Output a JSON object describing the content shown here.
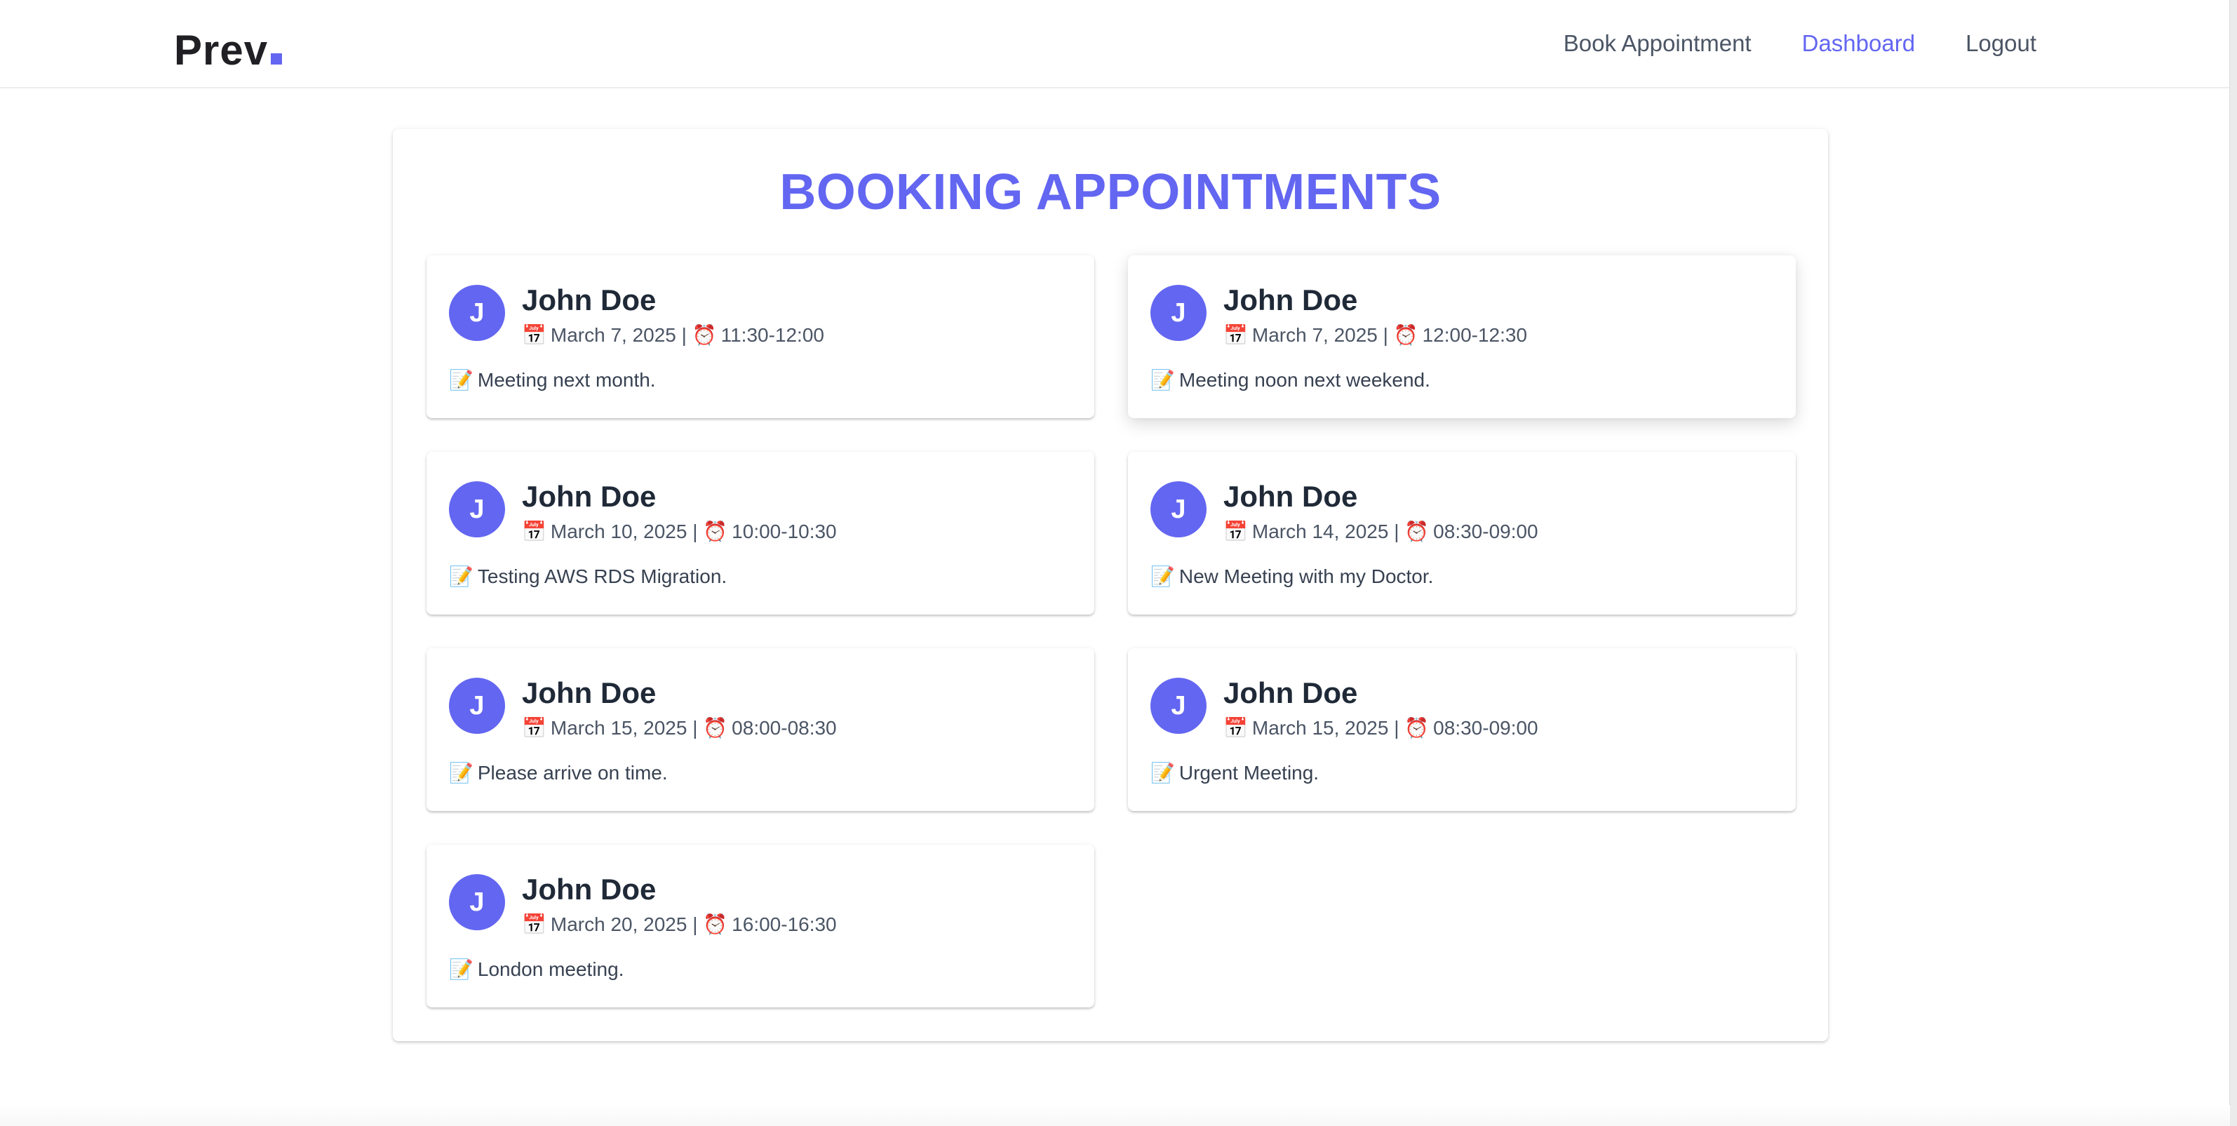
{
  "header": {
    "logo_text": "Prev",
    "nav": [
      {
        "label": "Book Appointment"
      },
      {
        "label": "Dashboard"
      },
      {
        "label": "Logout"
      }
    ]
  },
  "panel": {
    "title": "BOOKING APPOINTMENTS"
  },
  "icons": {
    "calendar": "📅",
    "clock": "⏰",
    "note": "📝"
  },
  "appointments": [
    {
      "initial": "J",
      "name": "John Doe",
      "date": "March 7, 2025",
      "time": "11:30-12:00",
      "note": "Meeting next month."
    },
    {
      "initial": "J",
      "name": "John Doe",
      "date": "March 7, 2025",
      "time": "12:00-12:30",
      "note": "Meeting noon next weekend."
    },
    {
      "initial": "J",
      "name": "John Doe",
      "date": "March 10, 2025",
      "time": "10:00-10:30",
      "note": "Testing AWS RDS Migration."
    },
    {
      "initial": "J",
      "name": "John Doe",
      "date": "March 14, 2025",
      "time": "08:30-09:00",
      "note": "New Meeting with my Doctor."
    },
    {
      "initial": "J",
      "name": "John Doe",
      "date": "March 15, 2025",
      "time": "08:00-08:30",
      "note": "Please arrive on time."
    },
    {
      "initial": "J",
      "name": "John Doe",
      "date": "March 15, 2025",
      "time": "08:30-09:00",
      "note": "Urgent Meeting."
    },
    {
      "initial": "J",
      "name": "John Doe",
      "date": "March 20, 2025",
      "time": "16:00-16:30",
      "note": "London meeting."
    }
  ],
  "colors": {
    "accent": "#6366f1",
    "text_dark": "#1f2937",
    "text_muted": "#4b5565"
  }
}
